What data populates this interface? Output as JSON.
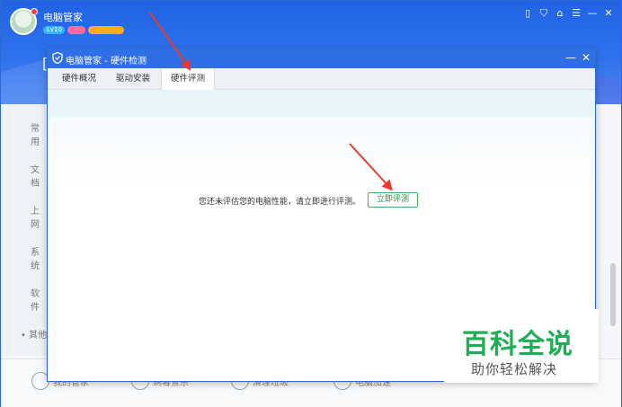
{
  "app": {
    "title": "电脑管家",
    "badges": [
      "Lv10",
      "",
      ""
    ],
    "peek_letter": "[",
    "window_controls": [
      "▯",
      "⛉",
      "⌂",
      "☰",
      "—",
      "✕"
    ],
    "sidebar_items": [
      "常用",
      "文档",
      "上网",
      "系统",
      "软件",
      "其他"
    ],
    "toolbar_items": [
      "我的管家",
      "病毒查杀",
      "清理垃圾",
      "电脑加速",
      ""
    ]
  },
  "dialog": {
    "title": "电脑管家 - 硬件检测",
    "minimize": "—",
    "close": "✕",
    "tabs": [
      {
        "label": "硬件概况",
        "active": false
      },
      {
        "label": "驱动安装",
        "active": false
      },
      {
        "label": "硬件评测",
        "active": true
      }
    ],
    "message": "您还未评估您的电脑性能，请立即进行评测。",
    "evaluate_button": "立即评测"
  },
  "watermark": {
    "main": "百科全说",
    "sub": "助你轻松解决"
  },
  "colors": {
    "header_blue": "#2f6fe6",
    "button_green": "#41b34f",
    "arrow_red": "#e63b2e",
    "watermark_green": "#1fae55"
  }
}
